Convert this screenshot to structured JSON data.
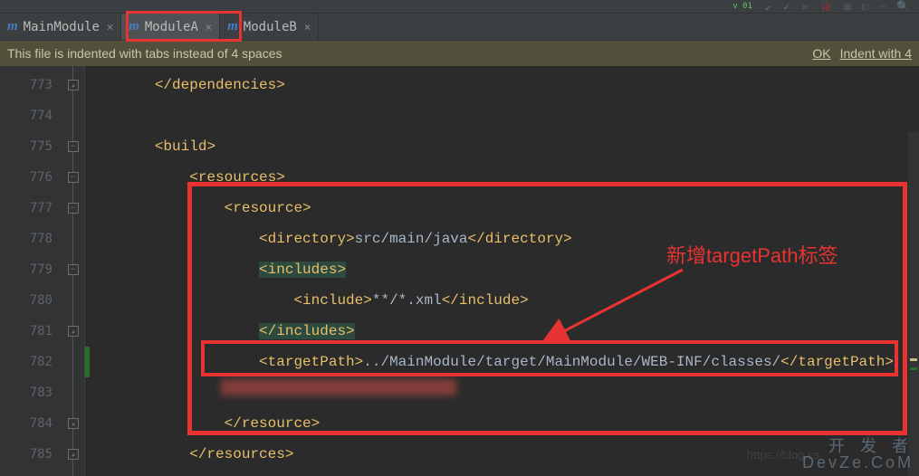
{
  "toolbar": {
    "version": "v 01"
  },
  "tabs": [
    {
      "label": "MainModule",
      "icon": "m"
    },
    {
      "label": "ModuleA",
      "icon": "m"
    },
    {
      "label": "ModuleB",
      "icon": "m"
    }
  ],
  "banner": {
    "message": "This file is indented with tabs instead of 4 spaces",
    "ok": "OK",
    "action": "Indent with 4"
  },
  "lines": {
    "start": 773,
    "end": 785
  },
  "code": {
    "l773": {
      "indent": "        ",
      "open": "</",
      "tag": "dependencies",
      "close": ">"
    },
    "l775": {
      "indent": "        ",
      "open": "<",
      "tag": "build",
      "close": ">"
    },
    "l776": {
      "indent": "            ",
      "open": "<",
      "tag": "resources",
      "close": ">"
    },
    "l777": {
      "indent": "                ",
      "open": "<",
      "tag": "resource",
      "close": ">"
    },
    "l778": {
      "indent": "                    ",
      "open": "<",
      "tag": "directory",
      "close": ">",
      "text": "src/main/java",
      "open2": "</",
      "tag2": "directory",
      "close2": ">"
    },
    "l779": {
      "indent": "                    ",
      "open": "<",
      "tag": "includes",
      "close": ">"
    },
    "l780": {
      "indent": "                        ",
      "open": "<",
      "tag": "include",
      "close": ">",
      "text": "**/*.xml",
      "open2": "</",
      "tag2": "include",
      "close2": ">"
    },
    "l781": {
      "indent": "                    ",
      "open": "</",
      "tag": "includes",
      "close": ">"
    },
    "l782": {
      "indent": "                    ",
      "open": "<",
      "tag": "targetPath",
      "close": ">",
      "text": "../MainModule/target/MainModule/WEB-INF/classes/",
      "open2": "</",
      "tag2": "targetPath",
      "close2": ">"
    },
    "l784": {
      "indent": "                ",
      "open": "</",
      "tag": "resource",
      "close": ">"
    },
    "l785": {
      "indent": "            ",
      "open": "</",
      "tag": "resources",
      "close": ">"
    }
  },
  "annotation": {
    "label": "新增targetPath标签"
  },
  "watermark": {
    "line1": "开 发 者",
    "line2": "DevZe.CoM",
    "blog": "https://blog.cs"
  }
}
